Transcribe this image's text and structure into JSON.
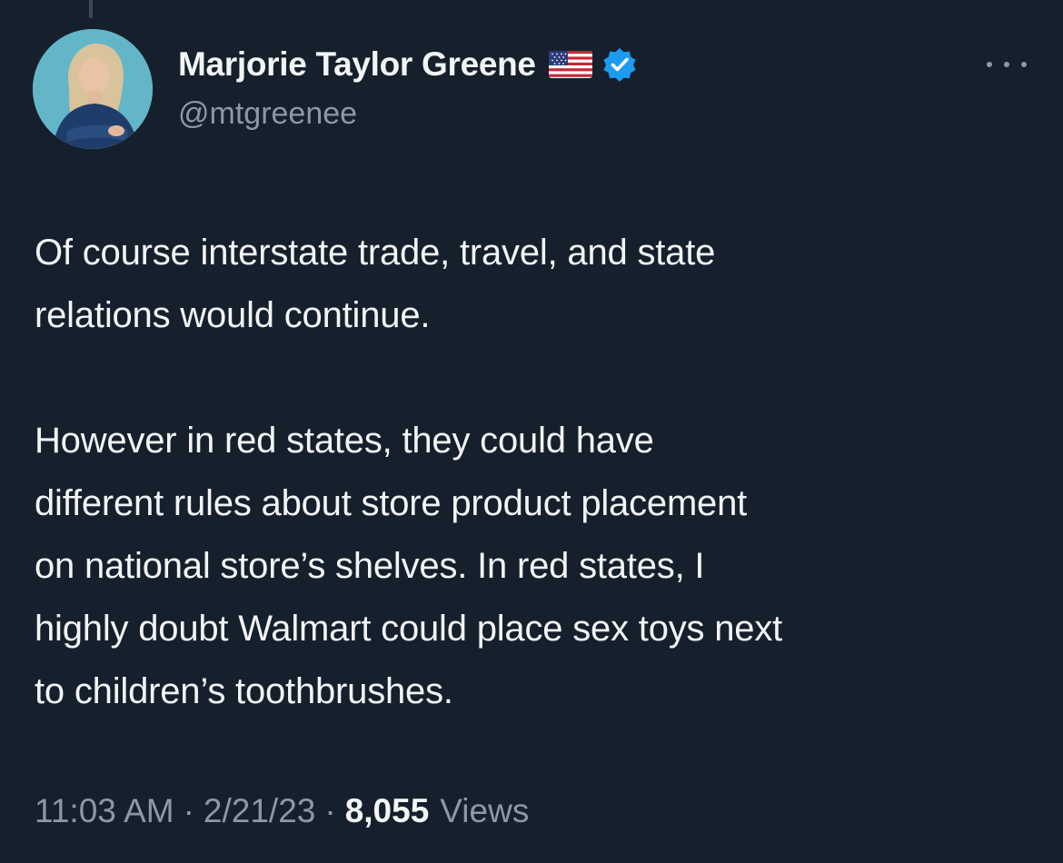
{
  "author": {
    "display_name": "Marjorie Taylor Greene",
    "handle": "@mtgreenee",
    "flag_icon": "us-flag-icon",
    "verified_icon": "verified-badge-icon",
    "verified_color": "#1d9bf0"
  },
  "tweet": {
    "paragraphs": [
      "Of course interstate trade, travel, and state\nrelations would continue.",
      "However in red states, they could have\ndifferent rules about store product placement\non national store’s shelves. In red states, I\nhighly doubt Walmart could place sex toys next\nto children’s toothbrushes."
    ]
  },
  "meta": {
    "time": "11:03 AM",
    "separator": "·",
    "date": "2/21/23",
    "views_count": "8,055",
    "views_label": "Views"
  },
  "colors": {
    "background": "#16202d",
    "primary_text": "#f2f4f5",
    "secondary_text": "#8b98a5"
  }
}
